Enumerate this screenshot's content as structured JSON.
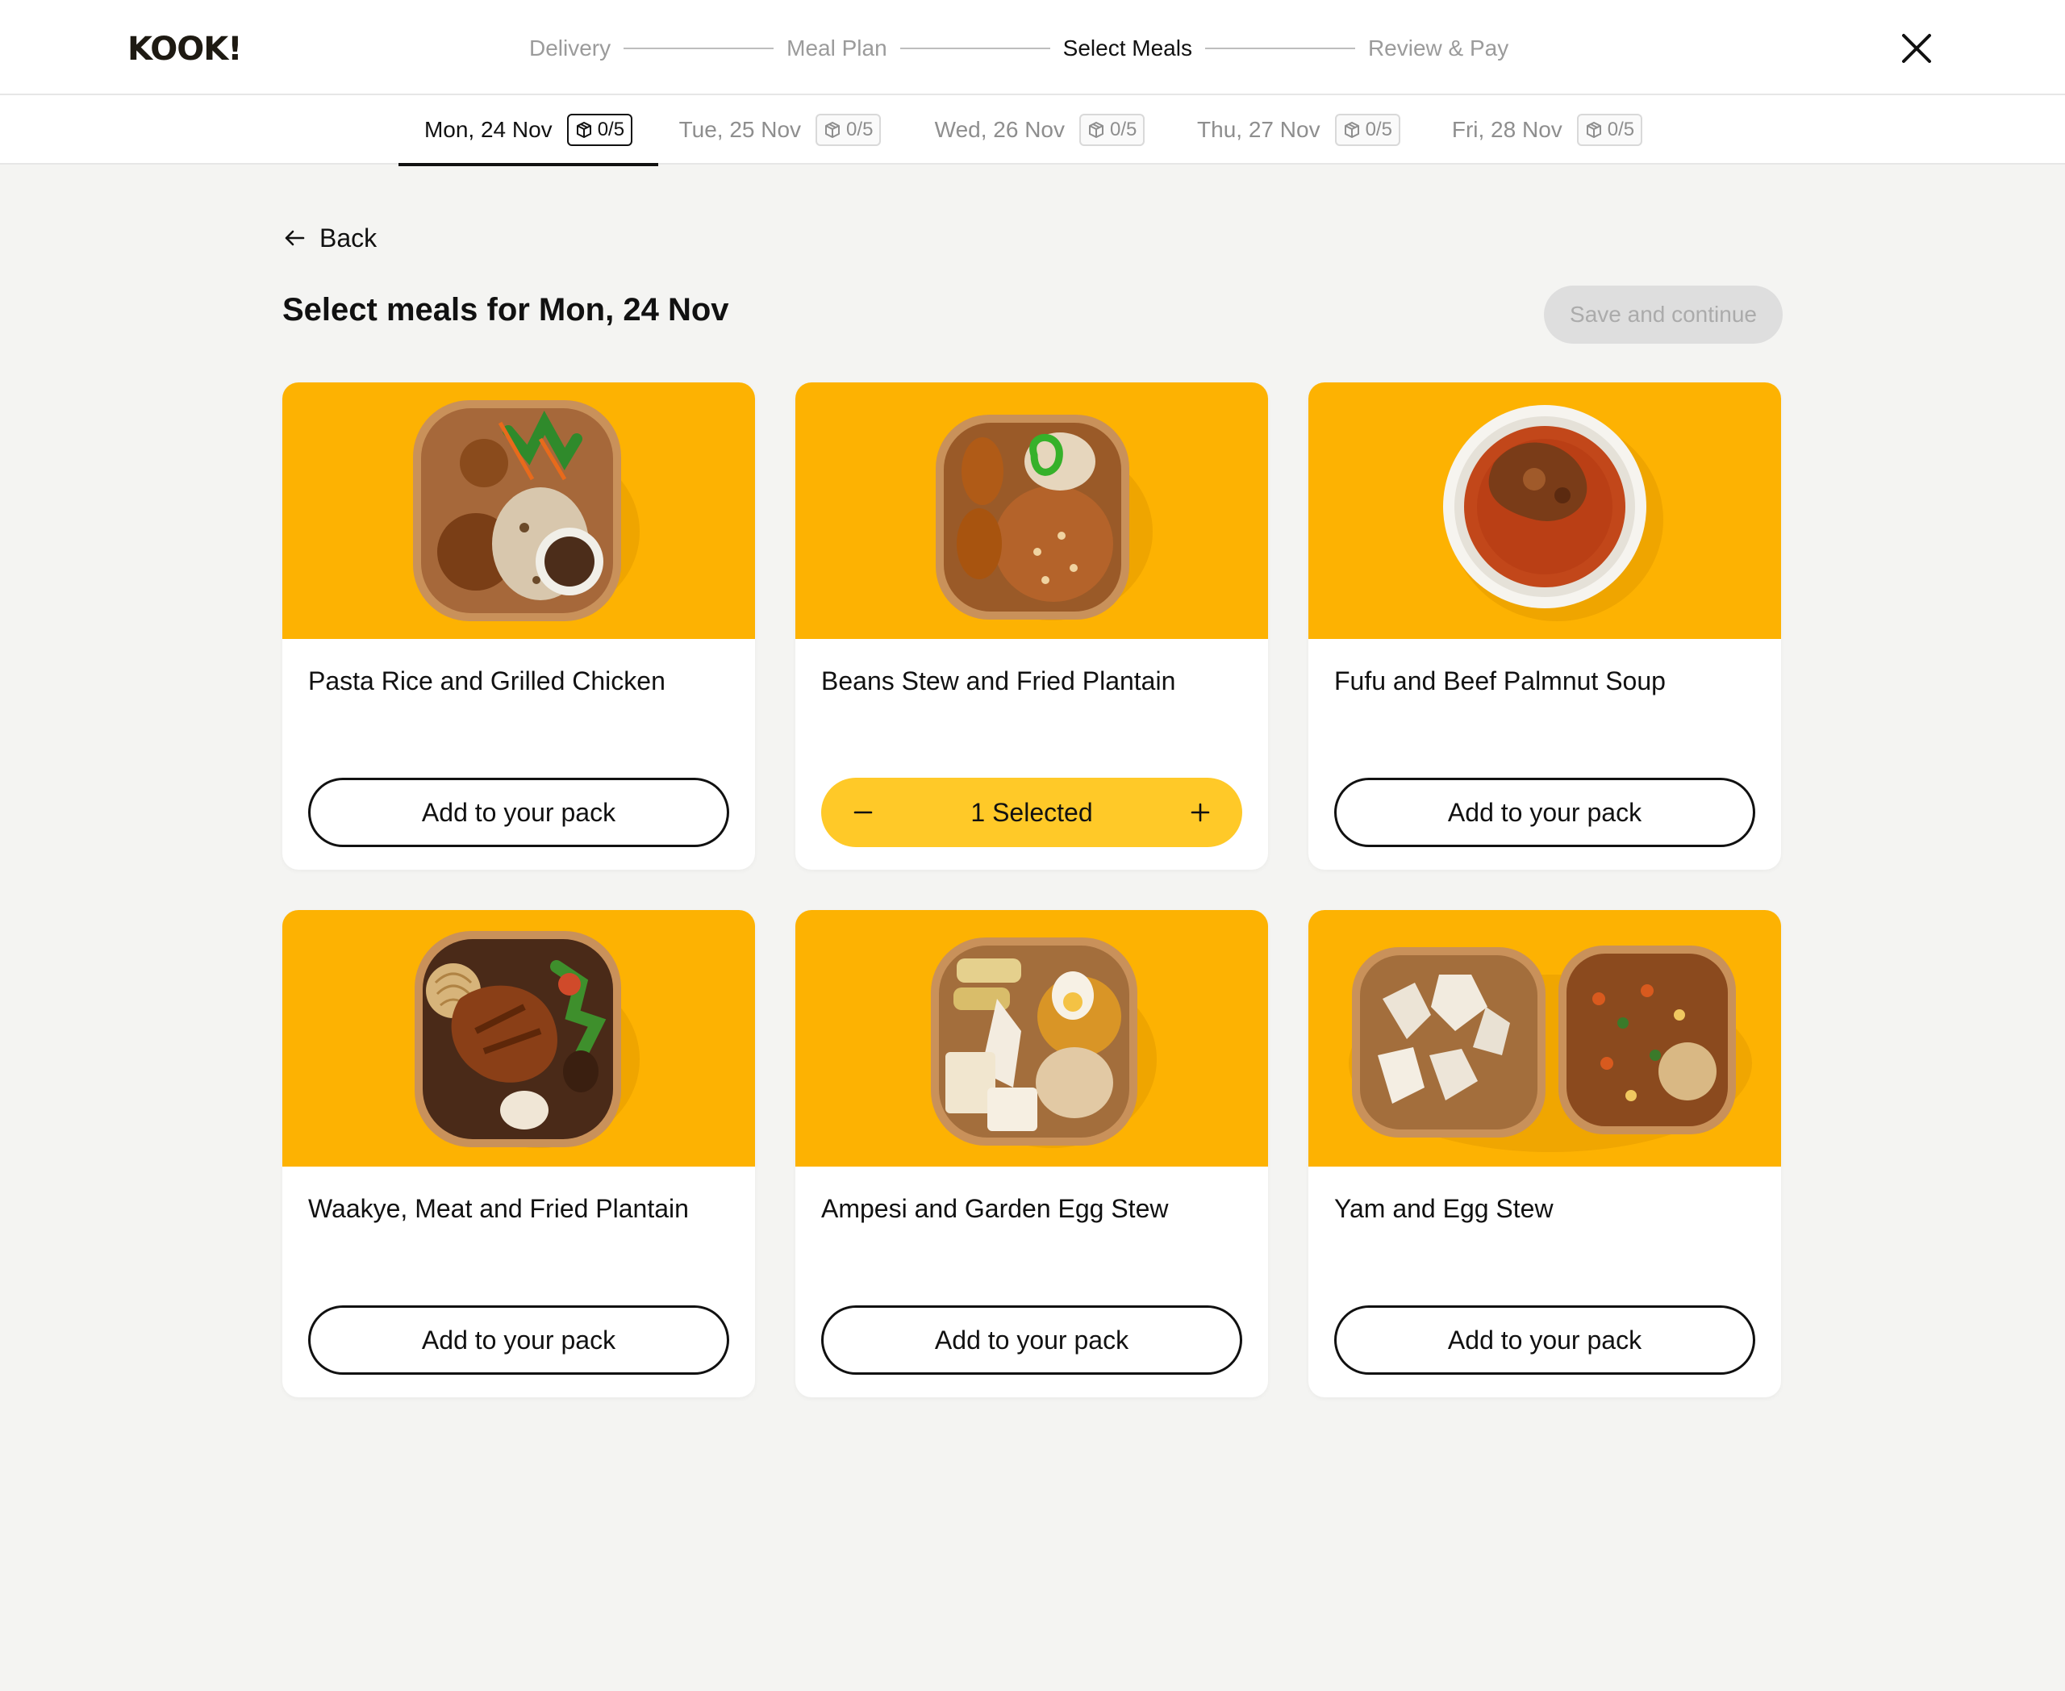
{
  "app": {
    "logo": "KOOK!"
  },
  "steps": [
    {
      "label": "Delivery",
      "active": false
    },
    {
      "label": "Meal Plan",
      "active": false
    },
    {
      "label": "Select Meals",
      "active": true
    },
    {
      "label": "Review & Pay",
      "active": false
    }
  ],
  "days": [
    {
      "label": "Mon, 24 Nov",
      "count": "0/5",
      "active": true
    },
    {
      "label": "Tue, 25 Nov",
      "count": "0/5",
      "active": false
    },
    {
      "label": "Wed, 26 Nov",
      "count": "0/5",
      "active": false
    },
    {
      "label": "Thu, 27 Nov",
      "count": "0/5",
      "active": false
    },
    {
      "label": "Fri, 28 Nov",
      "count": "0/5",
      "active": false
    }
  ],
  "back_label": "Back",
  "page_title": "Select meals for Mon, 24 Nov",
  "save_label": "Save and continue",
  "meals": [
    {
      "name": "Pasta Rice and Grilled Chicken",
      "action": "Add to your pack",
      "selected": false
    },
    {
      "name": "Beans Stew and Fried Plantain",
      "action": "1 Selected",
      "selected": true,
      "quantity": 1
    },
    {
      "name": "Fufu and Beef Palmnut Soup",
      "action": "Add to your pack",
      "selected": false
    },
    {
      "name": "Waakye, Meat and Fried Plantain",
      "action": "Add to your pack",
      "selected": false
    },
    {
      "name": "Ampesi and Garden Egg Stew",
      "action": "Add to your pack",
      "selected": false
    },
    {
      "name": "Yam and Egg Stew",
      "action": "Add to your pack",
      "selected": false
    }
  ],
  "colors": {
    "brand_yellow": "#fdb202",
    "selected_yellow": "#ffc928",
    "text": "#111111",
    "muted": "#9b9b9b",
    "disabled_bg": "#dedede"
  },
  "icons": {
    "close": "close-icon",
    "back": "arrow-left-icon",
    "badge": "box-icon",
    "minus": "minus-icon",
    "plus": "plus-icon"
  }
}
